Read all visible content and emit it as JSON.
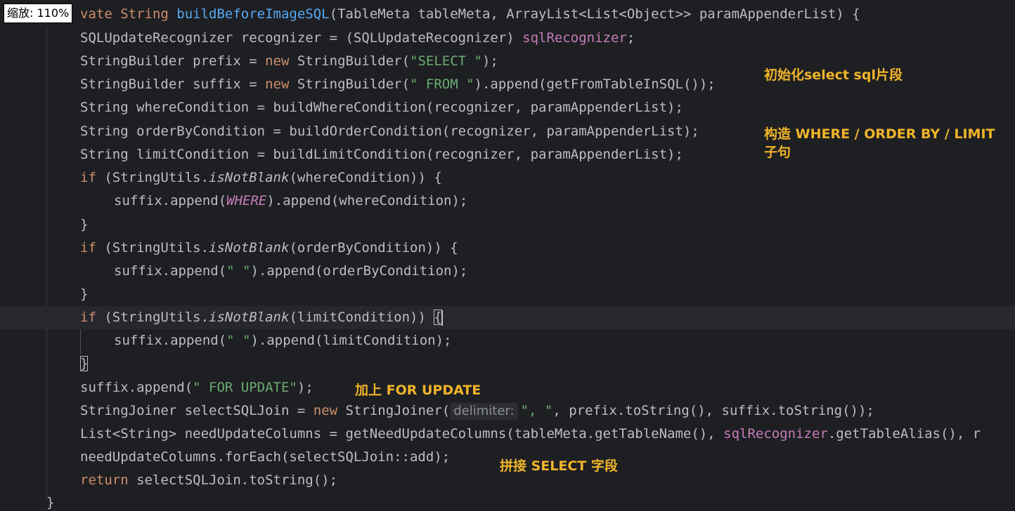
{
  "zoom": {
    "label": "缩放: 110%"
  },
  "annotations": {
    "init_select": "初始化select sql片段",
    "build_clauses": "构造 WHERE / ORDER BY / LIMIT 子句",
    "for_update": "加上 FOR UPDATE",
    "join_select": "拼接 SELECT 字段"
  },
  "code": {
    "l1": {
      "a": "vate String ",
      "b": "buildBeforeImageSQL",
      "c": "(TableMeta tableMeta, ArrayList<List<Object>> paramAppenderList) {"
    },
    "l2": {
      "a": "SQLUpdateRecognizer recognizer = (SQLUpdateRecognizer) ",
      "b": "sqlRecognizer",
      "c": ";"
    },
    "l3": {
      "a": "StringBuilder prefix = ",
      "b": "new",
      "c": " StringBuilder(",
      "d": "\"SELECT \"",
      "e": ");"
    },
    "l4": {
      "a": "StringBuilder suffix = ",
      "b": "new",
      "c": " StringBuilder(",
      "d": "\" FROM \"",
      "e": ").append(getFromTableInSQL());"
    },
    "l5": {
      "a": "String whereCondition = buildWhereCondition(recognizer, paramAppenderList);"
    },
    "l6": {
      "a": "String orderByCondition = buildOrderCondition(recognizer, paramAppenderList);"
    },
    "l7": {
      "a": "String limitCondition = buildLimitCondition(recognizer, paramAppenderList);"
    },
    "l8": {
      "a": "if",
      "b": " (StringUtils.",
      "c": "isNotBlank",
      "d": "(whereCondition)) {"
    },
    "l9": {
      "a": "suffix.append(",
      "b": "WHERE",
      "c": ").append(whereCondition);"
    },
    "l10": {
      "a": "}"
    },
    "l11": {
      "a": "if",
      "b": " (StringUtils.",
      "c": "isNotBlank",
      "d": "(orderByCondition)) {"
    },
    "l12": {
      "a": "suffix.append(",
      "b": "\" \"",
      "c": ").append(orderByCondition);"
    },
    "l13": {
      "a": "}"
    },
    "l14": {
      "a": "if",
      "b": " (StringUtils.",
      "c": "isNotBlank",
      "d": "(limitCondition)) ",
      "e": "{"
    },
    "l15": {
      "a": "suffix.append(",
      "b": "\" \"",
      "c": ").append(limitCondition);"
    },
    "l16": {
      "a": "}"
    },
    "l17": {
      "a": "suffix.append(",
      "b": "\" FOR UPDATE\"",
      "c": ");"
    },
    "l18": {
      "a": "StringJoiner selectSQLJoin = ",
      "b": "new",
      "c": " StringJoiner(",
      "hint": "delimiter:",
      "d": "\", \"",
      "e": ", prefix.toString(), suffix.toString());"
    },
    "l19": {
      "a": "List<String> needUpdateColumns = getNeedUpdateColumns(tableMeta.getTableName(), ",
      "b": "sqlRecognizer",
      "c": ".getTableAlias(), r"
    },
    "l20": {
      "a": "needUpdateColumns.forEach(selectSQLJoin::add);"
    },
    "l21": {
      "a": "return",
      "b": " selectSQLJoin.toString();"
    },
    "l22": {
      "a": "}"
    }
  }
}
